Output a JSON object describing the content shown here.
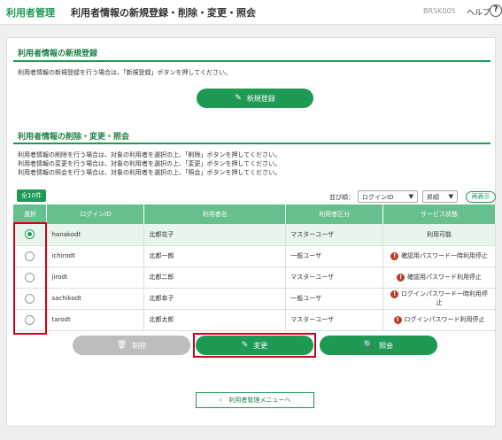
{
  "header": {
    "app_name": "利用者管理",
    "page_title": "利用者情報の新規登録・削除・変更・照会",
    "screen_id": "BRSK005",
    "help_label": "ヘルプ",
    "help_icon": "?"
  },
  "register": {
    "title": "利用者情報の新規登録",
    "description": "利用者情報の新規登録を行う場合は、「新規登録」ボタンを押してください。",
    "button_label": "新規登録",
    "button_icon": "pencil-icon"
  },
  "manage": {
    "title": "利用者情報の削除・変更・照会",
    "desc_lines": [
      "利用者情報の削除を行う場合は、対象の利用者を選択の上、「削除」ボタンを押してください。",
      "利用者情報の変更を行う場合は、対象の利用者を選択の上、「変更」ボタンを押してください。",
      "利用者情報の照会を行う場合は、対象の利用者を選択の上、「照会」ボタンを押してください。"
    ],
    "count_badge": "全10件",
    "sort_label": "並び順：",
    "sort_key": "ログインID",
    "sort_order": "昇順",
    "redisplay_label": "再表示",
    "columns": [
      "選択",
      "ログインID",
      "利用者名",
      "利用者区分",
      "サービス状態"
    ],
    "rows": [
      {
        "selected": true,
        "login_id": "hanakodt",
        "name": "北都花子",
        "type": "マスターユーザ",
        "status": "利用可能",
        "warn": false
      },
      {
        "selected": false,
        "login_id": "ichirodt",
        "name": "北都一朗",
        "type": "一般ユーザ",
        "status": "確認用パスワード一時利用停止",
        "warn": true
      },
      {
        "selected": false,
        "login_id": "jirodt",
        "name": "北都二郎",
        "type": "マスターユーザ",
        "status": "確認用パスワード利用停止",
        "warn": true
      },
      {
        "selected": false,
        "login_id": "sachikodt",
        "name": "北都幸子",
        "type": "一般ユーザ",
        "status": "ログインパスワード一時利用停止",
        "warn": true
      },
      {
        "selected": false,
        "login_id": "tarodt",
        "name": "北都太郎",
        "type": "マスターユーザ",
        "status": "ログインパスワード利用停止",
        "warn": true
      }
    ],
    "delete_label": "削除",
    "change_label": "変更",
    "inquiry_label": "照会"
  },
  "back_label": "利用者管理メニューへ",
  "colors": {
    "brand_green": "#1e9a55",
    "header_green": "#66bf8d",
    "highlight_red": "#d0021b",
    "warn_red": "#c0392b"
  }
}
